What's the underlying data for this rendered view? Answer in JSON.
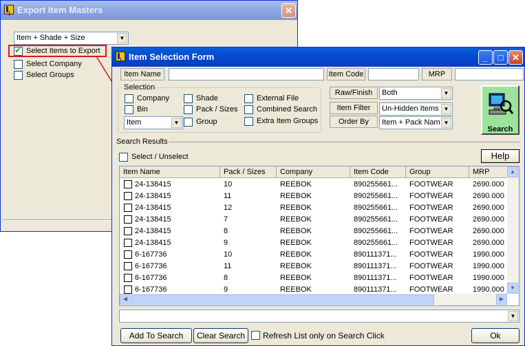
{
  "export_window": {
    "title": "Export Item Masters",
    "combo_value": "Item + Shade + Size",
    "options": [
      {
        "label": "Select Items to Export",
        "checked": true
      },
      {
        "label": "Select Company",
        "checked": false
      },
      {
        "label": "Select Groups",
        "checked": false
      }
    ]
  },
  "selection_form": {
    "title": "Item Selection Form",
    "filters": {
      "item_name_label": "Item Name",
      "item_code_label": "Item Code",
      "mrp_label": "MRP",
      "item_name_value": "",
      "item_code_value": "",
      "mrp_value": ""
    },
    "selection_group": {
      "title": "Selection",
      "checkboxes": [
        {
          "label": "Company",
          "checked": false
        },
        {
          "label": "Bin",
          "checked": false
        },
        {
          "label": "Shade",
          "checked": false
        },
        {
          "label": "Pack / Sizes",
          "checked": false
        },
        {
          "label": "Group",
          "checked": false
        },
        {
          "label": "External File",
          "checked": false
        },
        {
          "label": "Combined Search",
          "checked": false
        },
        {
          "label": "Extra Item Groups",
          "checked": false
        }
      ],
      "type_combo": "Item"
    },
    "raw_finish_label": "Raw/Finish",
    "raw_finish_value": "Both",
    "item_filter_label": "Item Filter",
    "item_filter_value": "Un-Hidden Items",
    "order_by_label": "Order By",
    "order_by_value": "Item + Pack  Nam",
    "search_button": "Search",
    "search_results_label": "Search Results",
    "select_unselect_label": "Select / Unselect",
    "help_button": "Help",
    "columns": [
      "Item Name",
      "Pack / Sizes",
      "Company",
      "Item Code",
      "Group",
      "MRP"
    ],
    "rows": [
      [
        "24-138415",
        "10",
        "REEBOK",
        "890255661...",
        "FOOTWEAR",
        "2690.000"
      ],
      [
        "24-138415",
        "11",
        "REEBOK",
        "890255661...",
        "FOOTWEAR",
        "2690.000"
      ],
      [
        "24-138415",
        "12",
        "REEBOK",
        "890255661...",
        "FOOTWEAR",
        "2690.000"
      ],
      [
        "24-138415",
        "7",
        "REEBOK",
        "890255661...",
        "FOOTWEAR",
        "2690.000"
      ],
      [
        "24-138415",
        "8",
        "REEBOK",
        "890255661...",
        "FOOTWEAR",
        "2690.000"
      ],
      [
        "24-138415",
        "9",
        "REEBOK",
        "890255661...",
        "FOOTWEAR",
        "2690.000"
      ],
      [
        "6-167736",
        "10",
        "REEBOK",
        "890111371...",
        "FOOTWEAR",
        "1990.000"
      ],
      [
        "6-167736",
        "11",
        "REEBOK",
        "890111371...",
        "FOOTWEAR",
        "1990.000"
      ],
      [
        "6-167736",
        "8",
        "REEBOK",
        "890111371...",
        "FOOTWEAR",
        "1990.000"
      ],
      [
        "6-167736",
        "9",
        "REEBOK",
        "890111371...",
        "FOOTWEAR",
        "1990.000"
      ]
    ],
    "bottom_combo_value": "",
    "add_to_search_button": "Add To Search",
    "clear_search_button": "Clear Search",
    "refresh_label": "Refresh List only on Search Click",
    "ok_button": "Ok"
  },
  "colors": {
    "highlight_box": "#e0141e",
    "title_active": "#0349d1",
    "window_face": "#ece9d8"
  }
}
